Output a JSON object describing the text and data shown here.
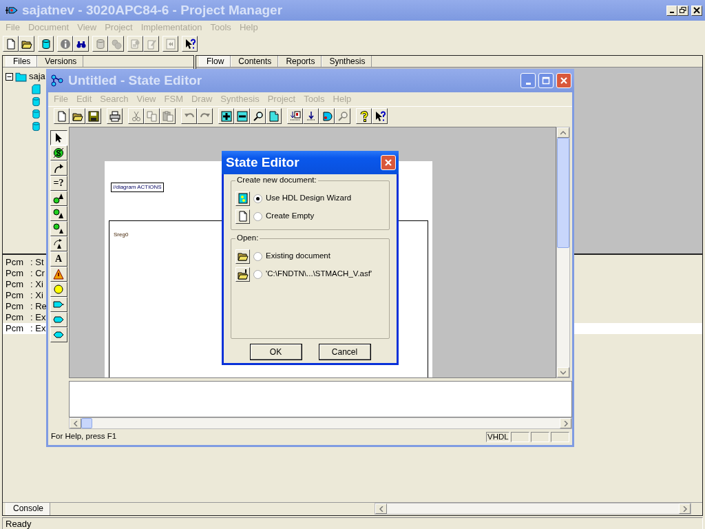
{
  "main_window": {
    "title": "sajatnev - 3020APC84-6 - Project Manager",
    "active": false,
    "menu": {
      "disabled": true,
      "items": [
        "File",
        "Document",
        "View",
        "Project",
        "Implementation",
        "Tools",
        "Help"
      ]
    },
    "toolbar": [
      [
        {
          "kind": "new",
          "disabled": false
        },
        {
          "kind": "open",
          "disabled": false
        }
      ],
      [
        {
          "kind": "cylinder",
          "disabled": false
        }
      ],
      [
        {
          "kind": "info",
          "disabled": false
        },
        {
          "kind": "binoculars",
          "disabled": false
        }
      ],
      [
        {
          "kind": "cylinder",
          "disabled": true
        },
        {
          "kind": "gears",
          "disabled": true
        }
      ],
      [
        {
          "kind": "doc-gear",
          "disabled": true
        },
        {
          "kind": "doc-edit",
          "disabled": true
        }
      ],
      [
        {
          "kind": "back",
          "disabled": true
        }
      ],
      [
        {
          "kind": "help-pointer",
          "disabled": false
        }
      ]
    ],
    "left_tabs": [
      {
        "label": "Files",
        "selected": true
      },
      {
        "label": "Versions",
        "selected": false
      }
    ],
    "tree": [
      {
        "label": "saja",
        "kind": "folder",
        "expanded": true,
        "children": [
          {
            "kind": "doc"
          },
          {
            "kind": "db"
          },
          {
            "kind": "db"
          },
          {
            "kind": "db"
          }
        ]
      }
    ],
    "right_tabs": [
      {
        "label": "Flow",
        "selected": true
      },
      {
        "label": "Contents",
        "selected": false
      },
      {
        "label": "Reports",
        "selected": false
      },
      {
        "label": "Synthesis",
        "selected": false
      }
    ],
    "console": [
      {
        "source": "Pcm",
        "message": ": St",
        "selected": false
      },
      {
        "source": "Pcm",
        "message": ": Cr",
        "selected": false
      },
      {
        "source": "Pcm",
        "message": ": Xi",
        "selected": false
      },
      {
        "source": "Pcm",
        "message": ": Xi",
        "selected": false
      },
      {
        "source": "Pcm",
        "message": ": Re",
        "selected": false
      },
      {
        "source": "Pcm",
        "message": ": Ex",
        "selected": false
      },
      {
        "source": "Pcm",
        "message": ": Ex",
        "selected": true
      }
    ],
    "bottom_tabs": [
      {
        "label": "Console",
        "selected": true
      }
    ],
    "status": "Ready"
  },
  "state_editor": {
    "title": "Untitled - State Editor",
    "active": false,
    "menu": {
      "disabled": true,
      "items": [
        "File",
        "Edit",
        "Search",
        "View",
        "FSM",
        "Draw",
        "Synthesis",
        "Project",
        "Tools",
        "Help"
      ]
    },
    "toolbar": [
      [
        {
          "kind": "new",
          "disabled": false
        },
        {
          "kind": "open",
          "disabled": false
        },
        {
          "kind": "save",
          "disabled": false
        }
      ],
      [
        {
          "kind": "print",
          "disabled": false
        }
      ],
      [
        {
          "kind": "cut",
          "disabled": true
        },
        {
          "kind": "copy",
          "disabled": true
        },
        {
          "kind": "paste",
          "disabled": true
        }
      ],
      [
        {
          "kind": "undo",
          "disabled": true
        },
        {
          "kind": "redo",
          "disabled": true
        }
      ],
      [
        {
          "kind": "zoom-in",
          "disabled": false
        },
        {
          "kind": "zoom-out",
          "disabled": false
        },
        {
          "kind": "magnifier",
          "disabled": false
        },
        {
          "kind": "page",
          "disabled": false
        }
      ],
      [
        {
          "kind": "import",
          "disabled": false
        },
        {
          "kind": "download",
          "disabled": false
        },
        {
          "kind": "gate",
          "disabled": false
        },
        {
          "kind": "magnifier",
          "disabled": true
        }
      ],
      [
        {
          "kind": "question",
          "disabled": false
        },
        {
          "kind": "help-pointer",
          "disabled": false
        }
      ]
    ],
    "palette": [
      {
        "kind": "pointer",
        "selected": true
      },
      {
        "kind": "state",
        "selected": false
      },
      {
        "kind": "transition",
        "selected": false
      },
      {
        "kind": "label",
        "label": "=?",
        "selected": false
      },
      {
        "kind": "action-a",
        "selected": false
      },
      {
        "kind": "action-b",
        "selected": false
      },
      {
        "kind": "action-c",
        "selected": false
      },
      {
        "kind": "action-d",
        "selected": false
      },
      {
        "kind": "label",
        "label": "A",
        "selected": false
      },
      {
        "kind": "warning",
        "selected": false
      },
      {
        "kind": "junction",
        "selected": false
      },
      {
        "kind": "port-in",
        "selected": false
      },
      {
        "kind": "port-out",
        "selected": false
      },
      {
        "kind": "port-bidir",
        "selected": false
      }
    ],
    "diagram": {
      "note": "//diagram ACTIONS",
      "machine": "Sreg0"
    },
    "status": {
      "message": "For Help, press F1",
      "language": "VHDL"
    }
  },
  "dialog": {
    "title": "State Editor",
    "active": true,
    "groups": [
      {
        "title": "Create new document:",
        "options": [
          {
            "kind": "wizard",
            "label": "Use HDL Design Wizard",
            "selected": true
          },
          {
            "kind": "new",
            "label": "Create Empty",
            "selected": false
          }
        ]
      },
      {
        "title": "Open:",
        "options": [
          {
            "kind": "open",
            "label": "Existing document",
            "selected": false
          },
          {
            "kind": "recent",
            "label": "'C:\\FNDTN\\...\\STMACH_V.asf'",
            "selected": false
          }
        ]
      }
    ],
    "buttons": [
      "OK",
      "Cancel"
    ]
  }
}
